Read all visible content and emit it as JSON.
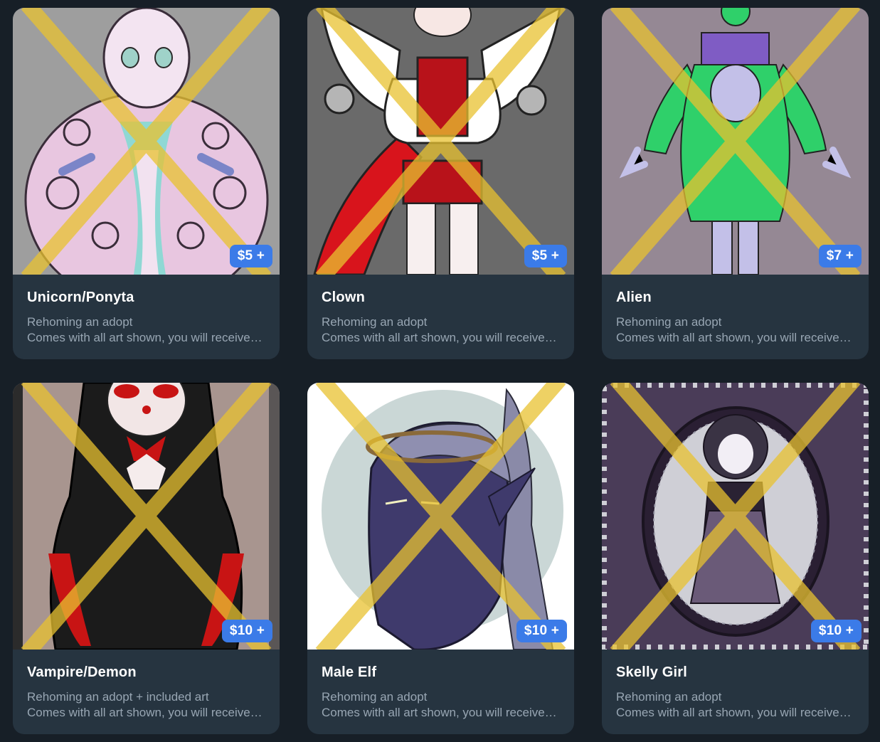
{
  "listings": [
    {
      "title": "Unicorn/Ponyta",
      "price": "$5 +",
      "subtitle": "Rehoming an adopt",
      "description": "Comes with all art shown, you will receive all files and full rights to the character",
      "background": "#9e9e9e",
      "accent": "#e6c3df"
    },
    {
      "title": "Clown",
      "price": "$5 +",
      "subtitle": "Rehoming an adopt",
      "description": "Comes with all art shown, you will receive all files and full rights to the character",
      "background": "#6a6a6a",
      "accent": "#d8141c"
    },
    {
      "title": "Alien",
      "price": "$7 +",
      "subtitle": "Rehoming an adopt",
      "description": "Comes with all art shown, you will receive all files and full rights to the character",
      "background": "#958894",
      "accent": "#2fd06a"
    },
    {
      "title": "Vampire/Demon",
      "price": "$10 +",
      "subtitle": "Rehoming an adopt + included art",
      "description": "Comes with all art shown, you will receive all files and full rights to the character",
      "background": "#a8958f",
      "accent": "#1b1b1b"
    },
    {
      "title": "Male Elf",
      "price": "$10 +",
      "subtitle": "Rehoming an adopt",
      "description": "Comes with all art shown, you will receive all files and full rights to the character",
      "background": "#ffffff",
      "accent": "#3f3a6c"
    },
    {
      "title": "Skelly Girl",
      "price": "$10 +",
      "subtitle": "Rehoming an adopt",
      "description": "Comes with all art shown, you will receive all files and full rights to the character",
      "background": "#4a3c58",
      "accent": "#d9d4df"
    }
  ],
  "colors": {
    "page_background": "#171f27",
    "card_background": "#263440",
    "price_badge": "#3b7be8",
    "watermark": "#e8c230"
  }
}
